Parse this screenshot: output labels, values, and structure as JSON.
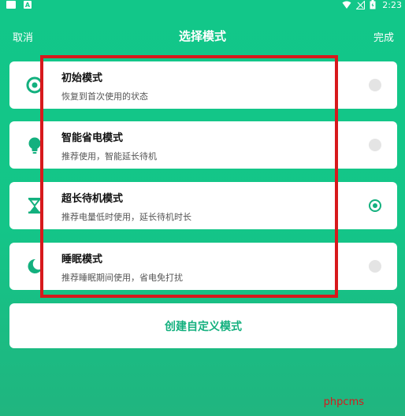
{
  "status_bar": {
    "time": "2:23",
    "notification_icon_label": "A"
  },
  "header": {
    "cancel_label": "取消",
    "title": "选择模式",
    "done_label": "完成"
  },
  "modes": [
    {
      "title": "初始模式",
      "description": "恢复到首次使用的状态",
      "icon": "target-icon",
      "selected": false
    },
    {
      "title": "智能省电模式",
      "description": "推荐使用，智能延长待机",
      "icon": "lightbulb-icon",
      "selected": false
    },
    {
      "title": "超长待机模式",
      "description": "推荐电量低时使用，延长待机时长",
      "icon": "hourglass-icon",
      "selected": true
    },
    {
      "title": "睡眠模式",
      "description": "推荐睡眠期间使用，省电免打扰",
      "icon": "moon-icon",
      "selected": false
    }
  ],
  "create_button_label": "创建自定义模式",
  "watermark": "phpcms",
  "colors": {
    "background": "#14c588",
    "accent": "#13b07e",
    "highlight": "#d7191c"
  }
}
